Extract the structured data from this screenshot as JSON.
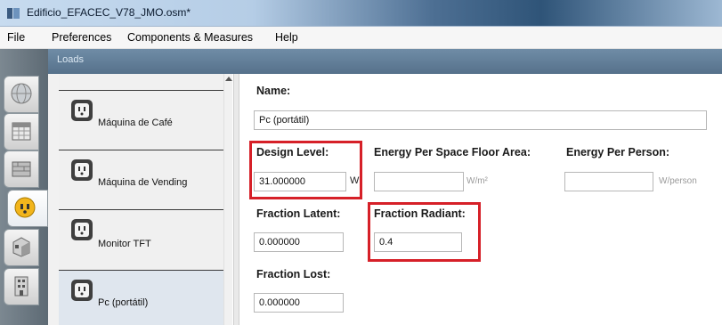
{
  "window": {
    "title": "Edificio_EFACEC_V78_JMO.osm*"
  },
  "menu": [
    "File",
    "Preferences",
    "Components & Measures",
    "Help"
  ],
  "tabs": [
    {
      "icon": "globe-icon",
      "active": false
    },
    {
      "icon": "calendar-icon",
      "active": false
    },
    {
      "icon": "construction-icon",
      "active": false
    },
    {
      "icon": "loads-icon",
      "active": true
    },
    {
      "icon": "space-types-icon",
      "active": false
    },
    {
      "icon": "building-icon",
      "active": false
    }
  ],
  "header": {
    "title": "Loads"
  },
  "list": {
    "items": [
      {
        "label": "",
        "selected": false
      },
      {
        "label": "Máquina de Café",
        "selected": false
      },
      {
        "label": "Máquina de Vending",
        "selected": false
      },
      {
        "label": "Monitor TFT",
        "selected": false
      },
      {
        "label": "Pc (portátil)",
        "selected": true
      }
    ]
  },
  "detail": {
    "name_label": "Name:",
    "name_value": "Pc (portátil)",
    "design_level_label": "Design Level:",
    "design_level_value": "31.000000",
    "design_level_unit": "W",
    "energy_per_area_label": "Energy Per Space Floor Area:",
    "energy_per_area_value": "",
    "energy_per_area_unit": "W/m²",
    "energy_per_person_label": "Energy Per Person:",
    "energy_per_person_value": "",
    "energy_per_person_unit": "W/person",
    "fraction_latent_label": "Fraction Latent:",
    "fraction_latent_value": "0.000000",
    "fraction_radiant_label": "Fraction Radiant:",
    "fraction_radiant_value": "0.4",
    "fraction_lost_label": "Fraction Lost:",
    "fraction_lost_value": "0.000000"
  },
  "colors": {
    "highlight": "#d62028",
    "header": "#5e7a94"
  }
}
